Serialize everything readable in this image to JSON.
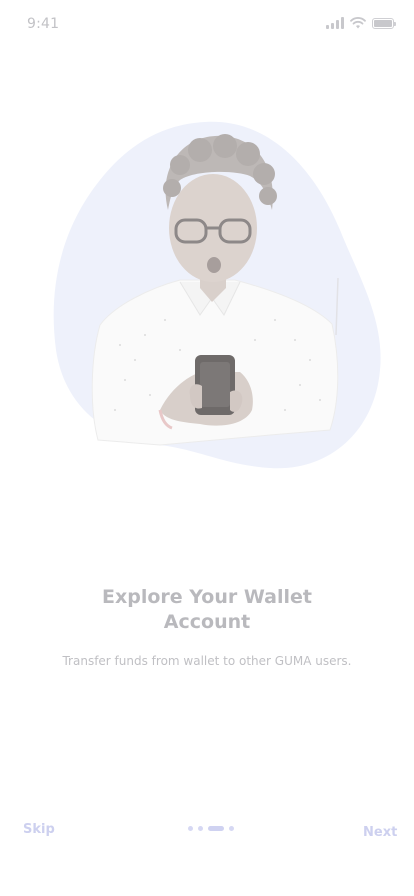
{
  "status_bar": {
    "time": "9:41",
    "icons": [
      "signal-icon",
      "wifi-icon",
      "battery-icon"
    ]
  },
  "onboarding": {
    "illustration": "woman-with-phone-illustration",
    "title_line1": "Explore Your Wallet",
    "title_line2": "Account",
    "description": "Transfer funds from wallet to other GUMA users."
  },
  "nav": {
    "skip_label": "Skip",
    "next_label": "Next",
    "page_count": 4,
    "active_page": 3
  },
  "colors": {
    "blob": "#eef1fb",
    "accent": "#cdd0ef",
    "text_muted": "#b9b9bd"
  }
}
